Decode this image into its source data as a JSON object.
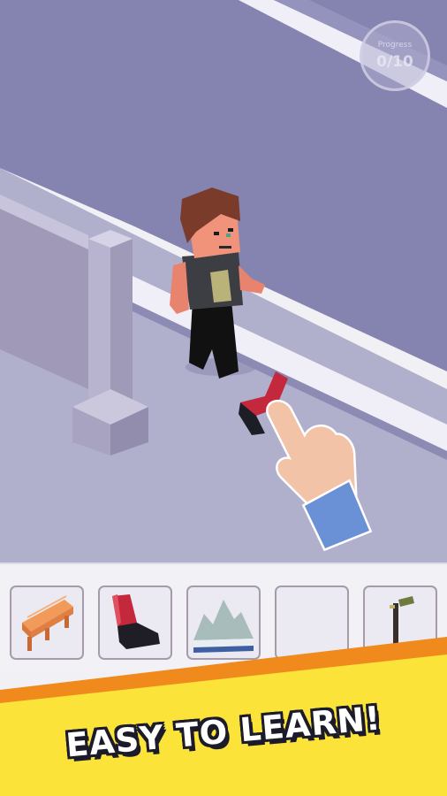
{
  "game": {
    "progress_label": "Progress",
    "progress_value": "0/10",
    "caption": "EASY TO LEARN!"
  },
  "tray": {
    "items": [
      {
        "name": "wooden-bench-piece"
      },
      {
        "name": "red-boot-piece"
      },
      {
        "name": "rock-pile-piece"
      },
      {
        "name": "empty-slot"
      },
      {
        "name": "street-lamp-piece"
      }
    ]
  },
  "colors": {
    "road": "#8281ad",
    "sidewalk": "#b0b0cc",
    "banner_yellow": "#fbe33a",
    "banner_orange": "#f08a1c"
  }
}
